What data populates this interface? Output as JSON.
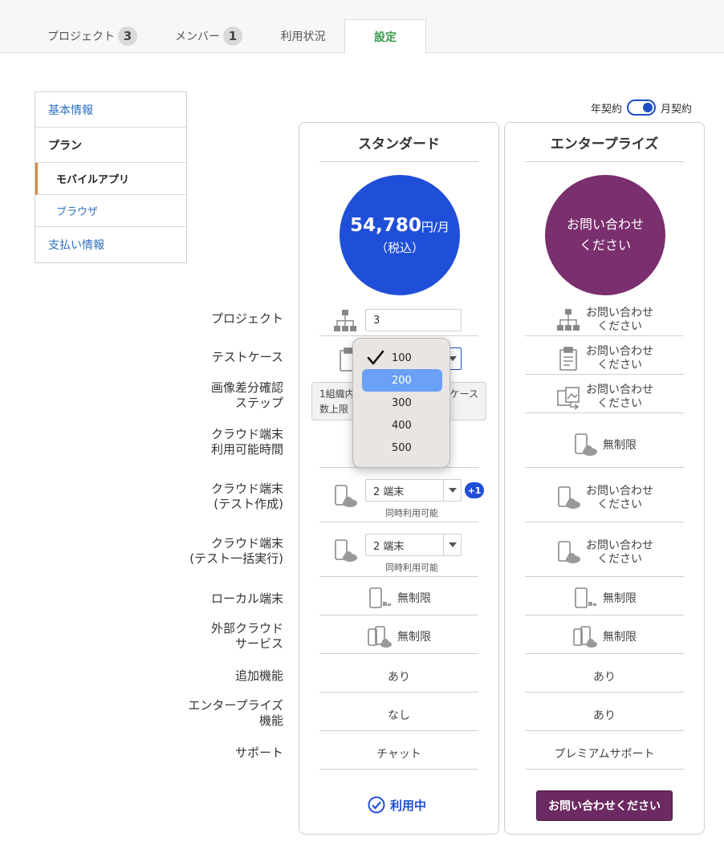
{
  "tabs": [
    {
      "label": "プロジェクト",
      "badge": "3"
    },
    {
      "label": "メンバー",
      "badge": "1"
    },
    {
      "label": "利用状況"
    },
    {
      "label": "設定"
    }
  ],
  "sidemenu": {
    "basic_info": "基本情報",
    "plan": "プラン",
    "mobile_app": "モバイルアプリ",
    "browser": "ブラウザ",
    "payment_info": "支払い情報"
  },
  "billing_toggle": {
    "left_label": "年契約",
    "right_label": "月契約",
    "state": "月契約"
  },
  "plans": {
    "standard": {
      "name": "スタンダード",
      "price": "54,780",
      "price_unit": "円/月",
      "price_note": "（税込）",
      "status": "利用中"
    },
    "enterprise": {
      "name": "エンタープライズ",
      "price_line1": "お問い合わせ",
      "price_line2": "ください",
      "cta": "お問い合わせください"
    }
  },
  "rows": {
    "project": {
      "label": "プロジェクト",
      "std_value": "3",
      "ent_value_1": "お問い合わせ",
      "ent_value_2": "ください"
    },
    "testcase": {
      "label": "テストケース",
      "ent_value_1": "お問い合わせ",
      "ent_value_2": "ください"
    },
    "image_diff": {
      "label_1": "画像差分確認",
      "label_2": "ステップ",
      "ent_value_1": "お問い合わせ",
      "ent_value_2": "ください"
    },
    "cloud_time": {
      "label_1": "クラウド端末",
      "label_2": "利用可能時間",
      "ent_value": "無制限"
    },
    "cloud_create": {
      "label_1": "クラウド端末",
      "label_2": "(テスト作成)",
      "std_value": "2 端末",
      "std_note": "同時利用可能",
      "std_extra": "+1",
      "ent_value_1": "お問い合わせ",
      "ent_value_2": "ください"
    },
    "cloud_batch": {
      "label_1": "クラウド端末",
      "label_2": "(テスト一括実行)",
      "std_value": "2 端末",
      "std_note": "同時利用可能",
      "ent_value_1": "お問い合わせ",
      "ent_value_2": "ください"
    },
    "local": {
      "label": "ローカル端末",
      "std_value": "無制限",
      "ent_value": "無制限"
    },
    "external_cloud": {
      "label_1": "外部クラウド",
      "label_2": "サービス",
      "std_value": "無制限",
      "ent_value": "無制限"
    },
    "extra_features": {
      "label": "追加機能",
      "std_value": "あり",
      "ent_value": "あり"
    },
    "enterprise_features": {
      "label_1": "エンタープライズ",
      "label_2": "機能",
      "std_value": "なし",
      "ent_value": "あり"
    },
    "support": {
      "label": "サポート",
      "std_value": "チャット",
      "ent_value": "プレミアムサポート"
    }
  },
  "tooltip": {
    "line1_a": "1組織内",
    "line1_b": "ケース",
    "line2": "数上限"
  },
  "testcase_dropdown": {
    "options": [
      "100",
      "200",
      "300",
      "400",
      "500"
    ],
    "checked": "100",
    "highlighted": "200"
  },
  "colors": {
    "accent_blue": "#1f4ed8",
    "enterprise_purple": "#7a2f6e",
    "active_tab_green": "#3a9c4c",
    "menu_link_blue": "#2e6fbf",
    "menu_active_bar": "#d38a47"
  }
}
